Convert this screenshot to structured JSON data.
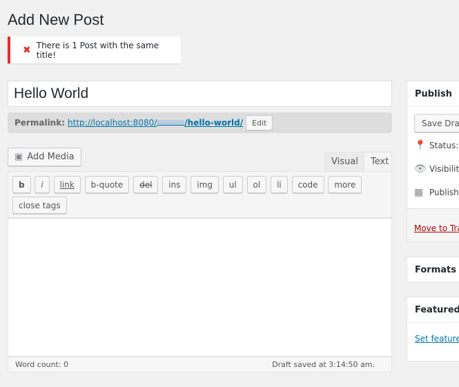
{
  "page_title": "Add New Post",
  "notice": {
    "icon": "error-x-icon",
    "text": "There is 1 Post with the same title!"
  },
  "post_title": "Hello World",
  "permalink": {
    "label": "Permalink:",
    "url_prefix": "http://localhost:8080/",
    "url_slug": "/hello-world/",
    "edit_label": "Edit"
  },
  "add_media_label": "Add Media",
  "tabs": {
    "visual": "Visual",
    "text": "Text"
  },
  "quicktags": [
    "b",
    "i",
    "link",
    "b-quote",
    "del",
    "ins",
    "img",
    "ul",
    "ol",
    "li",
    "code",
    "more",
    "close tags"
  ],
  "status_bar": {
    "word_count": "Word count: 0",
    "draft_saved": "Draft saved at 3:14:50 am."
  },
  "publish": {
    "title": "Publish",
    "save_draft": "Save Draf",
    "status": "Status:",
    "visibility": "Visibilit",
    "publish": "Publish",
    "trash": "Move to Tra"
  },
  "formats": {
    "title": "Formats"
  },
  "featured": {
    "title": "Featured I",
    "link": "Set featured"
  }
}
